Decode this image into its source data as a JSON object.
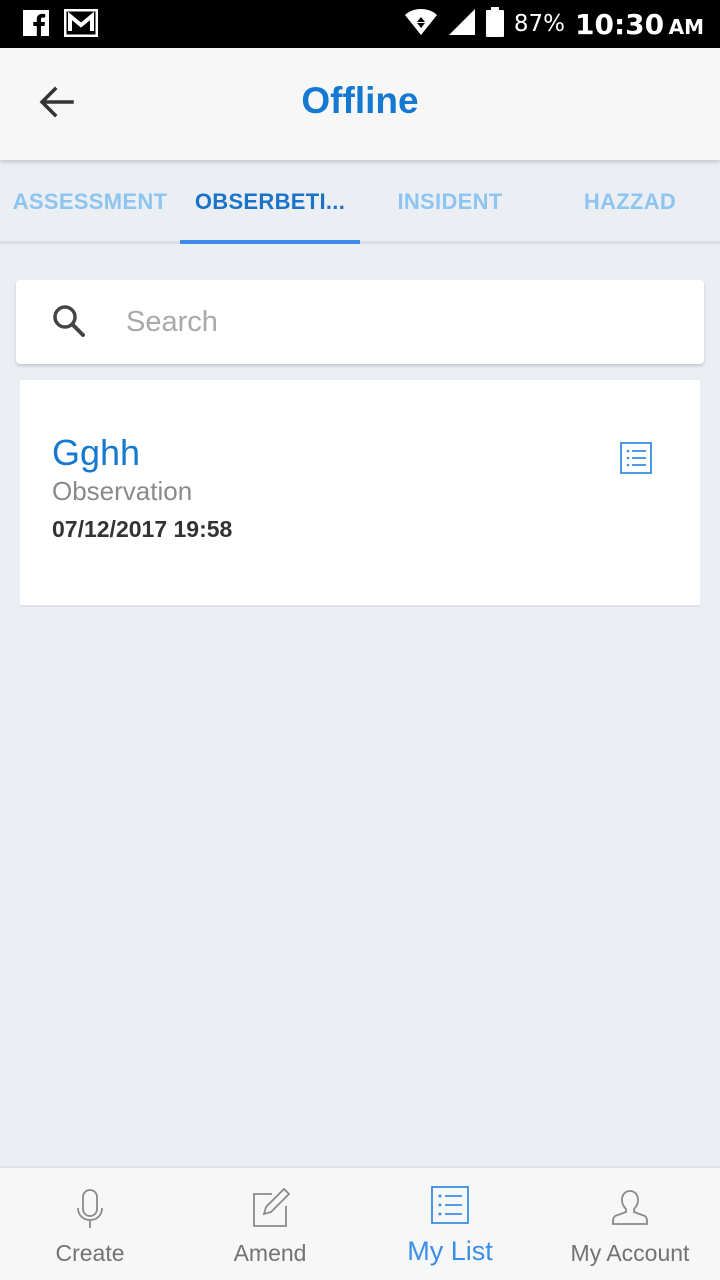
{
  "status_bar": {
    "battery_percent": "87%",
    "time": "10:30",
    "ampm": "AM",
    "icons": [
      "facebook-icon",
      "gmail-icon",
      "wifi-icon",
      "signal-icon",
      "battery-icon"
    ]
  },
  "header": {
    "title": "Offline",
    "back_icon": "arrow-left-icon"
  },
  "tabs": [
    {
      "label": "ASSESSMENT",
      "active": false
    },
    {
      "label": "OBSERBETI...",
      "active": true
    },
    {
      "label": "INSIDENT",
      "active": false
    },
    {
      "label": "HAZZAD",
      "active": false
    }
  ],
  "search": {
    "placeholder": "Search",
    "value": "",
    "icon": "search-icon"
  },
  "records": [
    {
      "title": "Gghh",
      "type": "Observation",
      "datetime": "07/12/2017 19:58",
      "icon": "list-icon"
    }
  ],
  "bottom_nav": [
    {
      "label": "Create",
      "icon": "microphone-icon",
      "active": false
    },
    {
      "label": "Amend",
      "icon": "edit-icon",
      "active": false
    },
    {
      "label": "My List",
      "icon": "list-icon",
      "active": true
    },
    {
      "label": "My Account",
      "icon": "user-icon",
      "active": false
    }
  ],
  "colors": {
    "accent": "#1479d0",
    "tab_inactive": "#8ec4f0",
    "nav_active": "#3a8ee6",
    "background": "#ebeff4"
  }
}
